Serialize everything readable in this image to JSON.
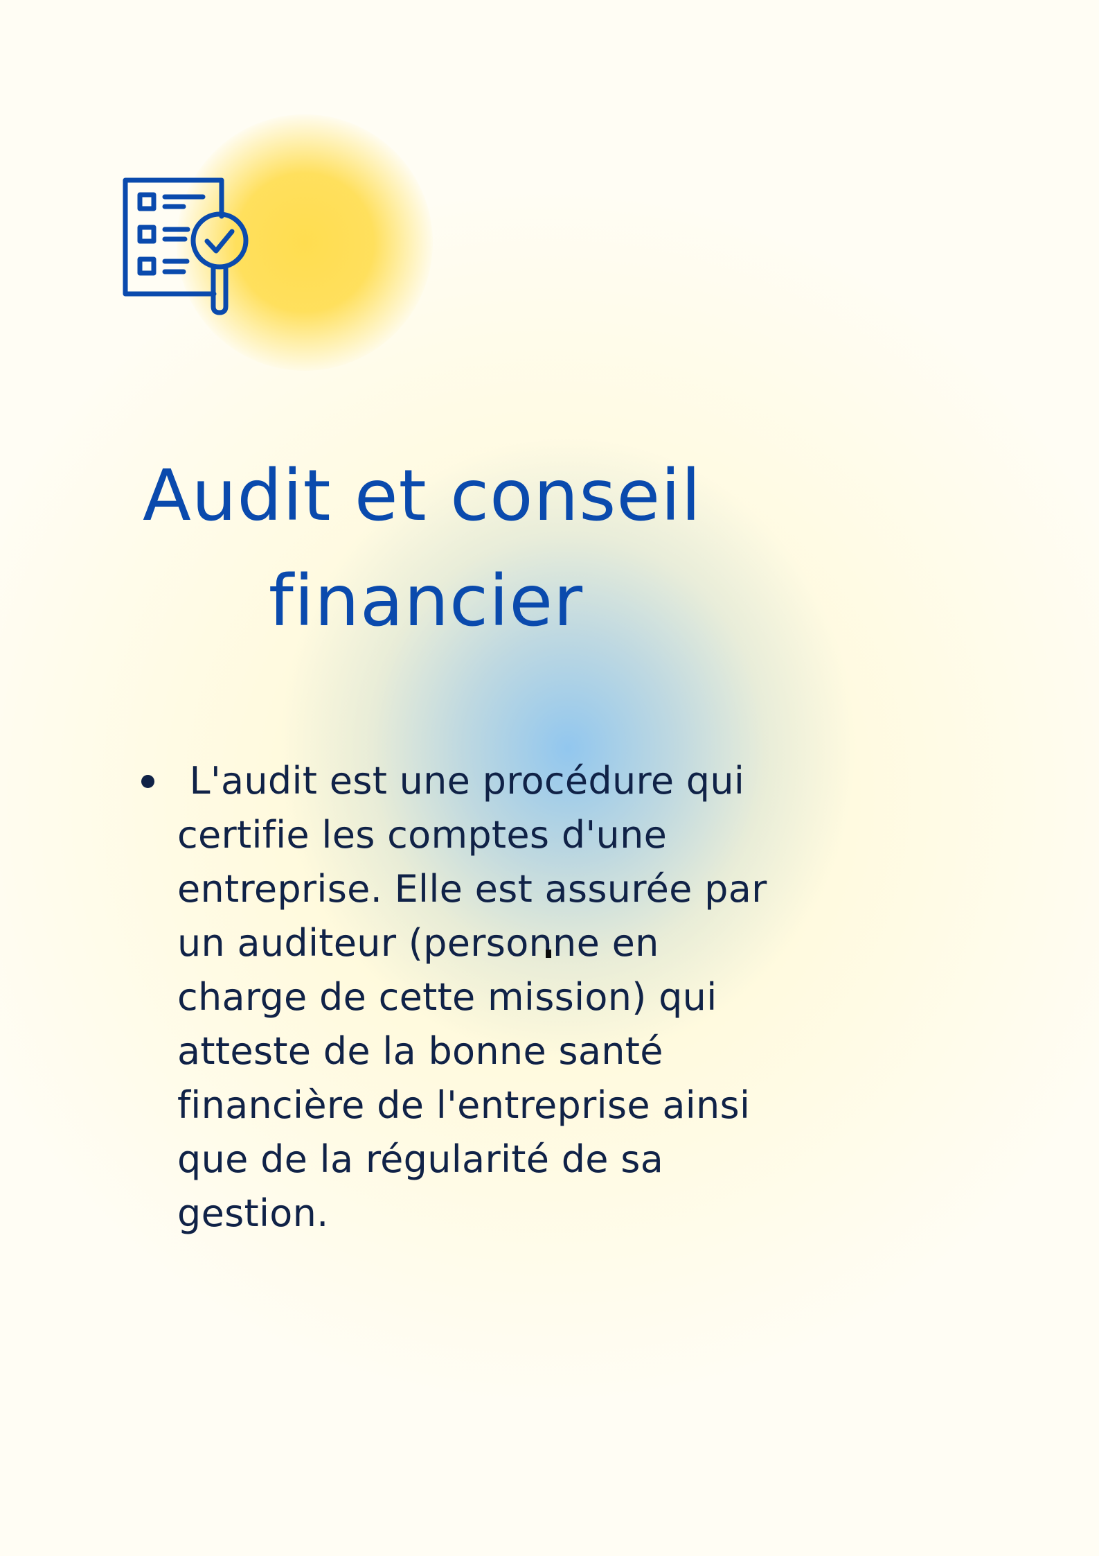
{
  "icon": "audit-checklist-magnifier-icon",
  "colors": {
    "title": "#0a4aad",
    "body_text": "#102247",
    "icon_stroke": "#0a4aad",
    "sun": "#ffdd55",
    "glow": "#8cc4f0"
  },
  "title": {
    "line1": "Audit et conseil",
    "line2": "financier"
  },
  "bullets": [
    {
      "text": " L'audit est une procédure qui certifie les comptes d'une entreprise. Elle est assurée par un auditeur (personne en charge de cette mission) qui atteste de la bonne santé financière de l'entreprise ainsi que de la régularité de sa gestion."
    }
  ]
}
